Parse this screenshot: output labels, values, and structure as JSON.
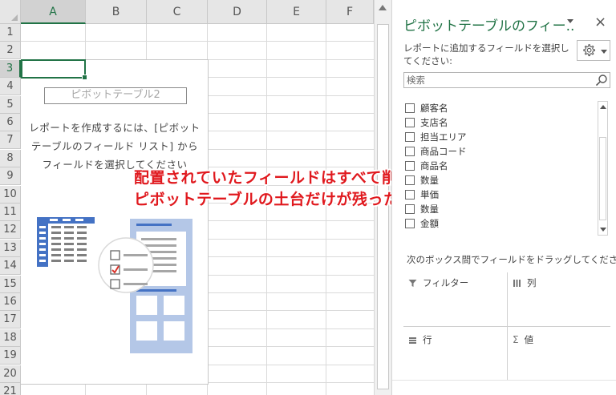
{
  "sheet": {
    "columns": [
      "A",
      "B",
      "C",
      "D",
      "E",
      "F"
    ],
    "rows": [
      "1",
      "2",
      "3",
      "4",
      "5",
      "6",
      "7",
      "8",
      "9",
      "10",
      "11",
      "12",
      "13",
      "14",
      "15",
      "16",
      "17",
      "18",
      "19",
      "20",
      "21"
    ],
    "selected_column": "A",
    "selected_row": "3"
  },
  "pivot_placeholder": {
    "name": "ピボットテーブル2",
    "instruction_line1": "レポートを作成するには、[ピボット",
    "instruction_line2": "テーブルのフィールド リスト] から",
    "instruction_line3": "フィールドを選択してください"
  },
  "caption": {
    "line1": "配置されていたフィールドはすべて削除され",
    "line2": "ピボットテーブルの土台だけが残った"
  },
  "pane": {
    "title": "ピボットテーブルのフィー..",
    "close_glyph": "×",
    "instruction": "レポートに追加するフィールドを選択してください:",
    "search_placeholder": "検索",
    "fields": [
      {
        "label": "顧客名"
      },
      {
        "label": "支店名"
      },
      {
        "label": "担当エリア"
      },
      {
        "label": "商品コード"
      },
      {
        "label": "商品名"
      },
      {
        "label": "数量"
      },
      {
        "label": "単価"
      },
      {
        "label": "数量"
      },
      {
        "label": "金額"
      }
    ],
    "drag_instruction": "次のボックス間でフィールドをドラッグしてください:",
    "areas": {
      "filter": "フィルター",
      "columns": "列",
      "rows": "行",
      "values": "値"
    },
    "area_icons": {
      "filter": "filter-icon",
      "columns": "columns-icon",
      "rows": "rows-icon",
      "values": "sigma-icon"
    }
  },
  "colors": {
    "excel_green": "#217346",
    "caption_red": "#e0191e",
    "illustration_blue": "#4472c4",
    "checkmark_red": "#d9342b"
  }
}
